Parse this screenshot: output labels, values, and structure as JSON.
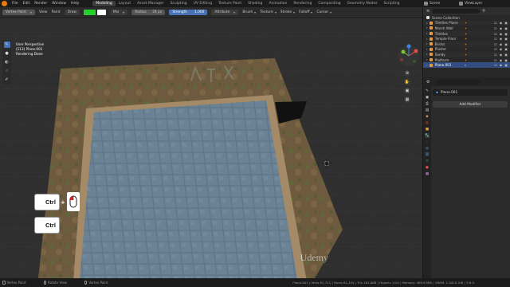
{
  "menu": {
    "items": [
      "File",
      "Edit",
      "Render",
      "Window",
      "Help"
    ],
    "workspaces": [
      "Modeling",
      "Layout",
      "Asset Manager",
      "Sculpting",
      "UV Editing",
      "Texture Paint",
      "Shading",
      "Animation",
      "Rendering",
      "Compositing",
      "Geometry Nodes",
      "Scripting"
    ],
    "active_workspace": "Modeling",
    "scene_label": "Scene",
    "view_layer_label": "ViewLayer"
  },
  "tool_header": {
    "mode": "Vertex Paint",
    "view": "View",
    "paint": "Paint",
    "brush_name": "Draw",
    "blend": "Mix",
    "radius_label": "Radius",
    "radius_value": "24 px",
    "strength_label": "Strength",
    "strength_value": "1.000",
    "attribute": "Attribute",
    "brush_menu": "Brush",
    "texture_menu": "Texture",
    "stroke_menu": "Stroke",
    "falloff_menu": "Falloff",
    "cursor_menu": "Cursor"
  },
  "viewport": {
    "perspective": "User Perspective",
    "object_line": "(113) Plane.001",
    "status_line": "Rendering Done"
  },
  "keys": {
    "ctrl1": "Ctrl",
    "plus": "+",
    "ctrl2": "Ctrl"
  },
  "outliner": {
    "title": "Scene Collection",
    "rows": [
      {
        "label": "Scene Collection",
        "type": "collection"
      },
      {
        "label": "Tiletiles Plane",
        "type": "mesh"
      },
      {
        "label": "Marsh Wall",
        "type": "mesh"
      },
      {
        "label": "Tiletiles",
        "type": "mesh"
      },
      {
        "label": "Temple Floor",
        "type": "mesh"
      },
      {
        "label": "Bricks",
        "type": "mesh"
      },
      {
        "label": "Plaster",
        "type": "mesh"
      },
      {
        "label": "Sandy",
        "type": "mesh"
      },
      {
        "label": "Platform",
        "type": "mesh"
      },
      {
        "label": "Plane.001",
        "type": "mesh",
        "selected": true
      }
    ]
  },
  "properties": {
    "object_name": "Plane.001",
    "add_modifier": "Add Modifier"
  },
  "statusbar": {
    "item1": "Vertex Paint",
    "item2": "Rotate View",
    "item3": "Vertex Paint",
    "stats": "Plane.001 | Verts 81,711 | Faces 81,434 | Tris 162,868 | Objects 1/10 | Memory: 469.6 MiB | VRAM: 1.5/8.0 GiB | 3.6.0"
  },
  "watermark": "Udemy",
  "colors": {
    "accent_blue": "#4772b3",
    "brush_color": "#24d12a",
    "selection": "#334d80",
    "orange_origin": "#e87d0d"
  }
}
